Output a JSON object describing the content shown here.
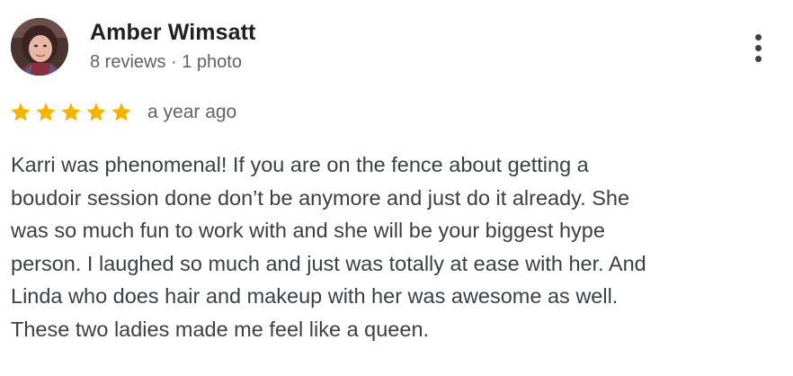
{
  "reviewer": {
    "name": "Amber Wimsatt",
    "meta": "8 reviews · 1 photo",
    "avatar_icon": "profile-photo"
  },
  "menu": {
    "icon": "more-vertical-icon"
  },
  "rating": {
    "stars": 5,
    "max_stars": 5,
    "star_color": "#F4B400",
    "date": "a year ago"
  },
  "review": {
    "lines": [
      "Karri was phenomenal! If you are on the fence about getting a",
      "boudoir session done don’t be anymore and just do it already. She",
      "was so much fun to work with and she will be your biggest hype",
      "person. I laughed so much and just was totally at ease with her. And",
      "Linda who does hair and makeup with her was awesome as well.",
      "These two ladies made me feel like a queen."
    ]
  }
}
